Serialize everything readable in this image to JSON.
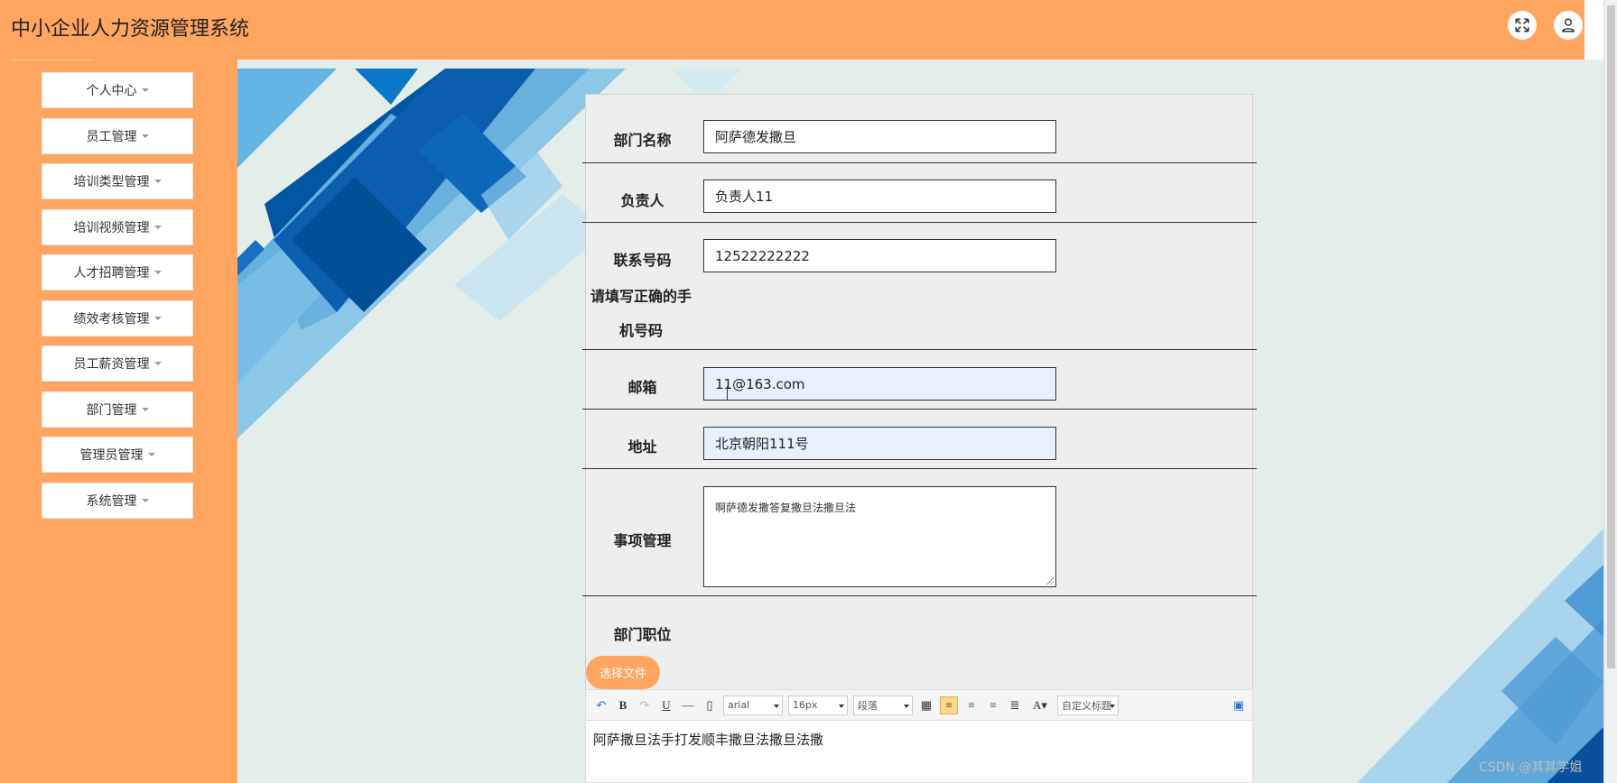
{
  "app": {
    "title": "中小企业人力资源管理系统"
  },
  "header": {
    "fullscreen_icon": "expand-icon",
    "user_icon": "user-icon"
  },
  "sidebar": {
    "items": [
      {
        "label": "个人中心"
      },
      {
        "label": "员工管理"
      },
      {
        "label": "培训类型管理"
      },
      {
        "label": "培训视频管理"
      },
      {
        "label": "人才招聘管理"
      },
      {
        "label": "绩效考核管理"
      },
      {
        "label": "员工薪资管理"
      },
      {
        "label": "部门管理"
      },
      {
        "label": "管理员管理"
      },
      {
        "label": "系统管理"
      }
    ]
  },
  "form": {
    "dept_name": {
      "label": "部门名称",
      "value": "阿萨德发撒旦"
    },
    "manager": {
      "label": "负责人",
      "value": "负责人11"
    },
    "phone": {
      "label": "联系号码",
      "value": "12522222222",
      "warning": "请填写正确的手机号码"
    },
    "email": {
      "label": "邮箱",
      "value": "11@163.com"
    },
    "address": {
      "label": "地址",
      "value": "北京朝阳111号"
    },
    "matters": {
      "label": "事项管理",
      "value": "啊萨德发撒答复撒旦法撒旦法"
    },
    "positions": {
      "label": "部门职位",
      "file_button": "选择文件"
    }
  },
  "editor": {
    "font_family": "arial",
    "font_size": "16px",
    "paragraph": "段落",
    "custom_heading": "自定义标题",
    "content": "阿萨撒旦法手打发顺丰撒旦法撒旦法撒"
  },
  "watermark": "CSDN @其其学姐",
  "colors": {
    "accent": "#FFA560",
    "background": "#E3EEEA",
    "card": "#EEEEEE"
  }
}
